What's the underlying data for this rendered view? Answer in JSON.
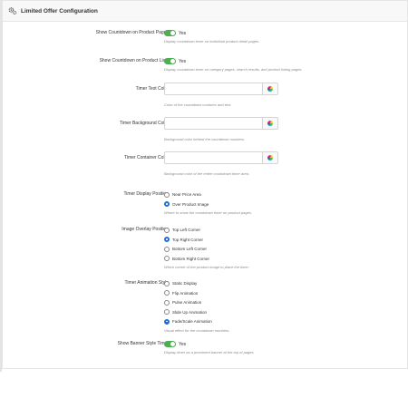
{
  "panel": {
    "title": "Limited Offer Configuration",
    "icon": "gears-icon"
  },
  "accent_color": "#4caf50",
  "radio_color": "#1e6fd9",
  "fields": {
    "countdown_product_pages": {
      "label": "Show Countdown on Product Pages",
      "value": "Yes",
      "help": "Display countdown timer on individual product detail pages."
    },
    "countdown_product_lists": {
      "label": "Show Countdown on Product Lists",
      "value": "Yes",
      "help": "Display countdown timer on category pages, search results, and product listing pages."
    },
    "timer_text_color": {
      "label": "Timer Text Color",
      "value": "",
      "help": "Color of the countdown numbers and text."
    },
    "timer_background_color": {
      "label": "Timer Background Color",
      "value": "",
      "help": "Background color behind the countdown numbers."
    },
    "timer_container_color": {
      "label": "Timer Container Color",
      "value": "",
      "help": "Background color of the entire countdown timer area."
    },
    "timer_display_position": {
      "label": "Timer Display Position",
      "options": [
        "Near Price Area",
        "Over Product Image"
      ],
      "selected": "Over Product Image",
      "help": "Where to show the countdown timer on product pages."
    },
    "image_overlay_position": {
      "label": "Image Overlay Position",
      "options": [
        "Top Left Corner",
        "Top Right Corner",
        "Bottom Left Corner",
        "Bottom Right Corner"
      ],
      "selected": "Top Right Corner",
      "help": "Which corner of the product image to place the timer."
    },
    "timer_animation_style": {
      "label": "Timer Animation Style",
      "options": [
        "Static Display",
        "Flip Animation",
        "Pulse Animation",
        "Slide Up Animation",
        "Fade/Scale Animation"
      ],
      "selected": "Fade/Scale Animation",
      "help": "Visual effect for the countdown numbers."
    },
    "banner_style_timer": {
      "label": "Show Banner Style Timer",
      "value": "Yes",
      "help": "Display timer as a prominent banner at the top of pages."
    }
  }
}
